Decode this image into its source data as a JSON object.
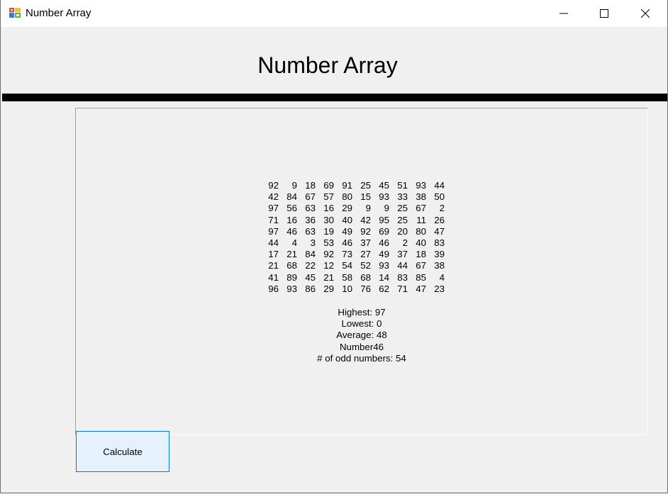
{
  "window": {
    "title": "Number Array",
    "app_icon": "winforms-app-icon",
    "controls": [
      "minimize-icon",
      "maximize-icon",
      "close-icon"
    ]
  },
  "heading": "Number Array",
  "array_rows": [
    [
      "92",
      "9",
      "18",
      "69",
      "91",
      "25",
      "45",
      "51",
      "93",
      "44"
    ],
    [
      "42",
      "84",
      "67",
      "57",
      "80",
      "15",
      "93",
      "33",
      "38",
      "50"
    ],
    [
      "97",
      "56",
      "63",
      "16",
      "29",
      "9",
      "9",
      "25",
      "67",
      "2"
    ],
    [
      "71",
      "16",
      "36",
      "30",
      "40",
      "42",
      "95",
      "25",
      "11",
      "26"
    ],
    [
      "97",
      "46",
      "63",
      "19",
      "49",
      "92",
      "69",
      "20",
      "80",
      "47"
    ],
    [
      "44",
      "4",
      "3",
      "53",
      "46",
      "37",
      "46",
      "2",
      "40",
      "83"
    ],
    [
      "17",
      "21",
      "84",
      "92",
      "73",
      "27",
      "49",
      "37",
      "18",
      "39"
    ],
    [
      "21",
      "68",
      "22",
      "12",
      "54",
      "52",
      "93",
      "44",
      "67",
      "38"
    ],
    [
      "41",
      "89",
      "45",
      "21",
      "58",
      "68",
      "14",
      "83",
      "85",
      "4"
    ],
    [
      "96",
      "93",
      "86",
      "29",
      "10",
      "76",
      "62",
      "71",
      "47",
      "23"
    ]
  ],
  "stats": {
    "highest": "Highest: 97",
    "lowest": "Lowest: 0",
    "average": "Average: 48",
    "number": "Number46",
    "odd_count": "# of odd numbers: 54"
  },
  "calculate_button": "Calculate",
  "colors": {
    "button_bg": "#e5f1fb",
    "button_border": "#0078d7",
    "window_bg": "#f0f0f0",
    "rule": "#000000"
  }
}
